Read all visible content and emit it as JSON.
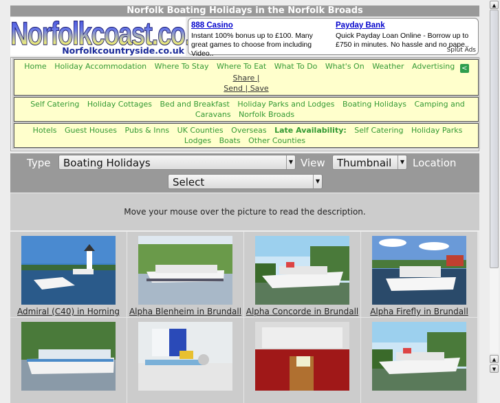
{
  "title": "Norfolk Boating Holidays in the Norfolk Broads",
  "logo": {
    "main": "Norfolkcoast.co.uk",
    "sub": "Norfolkcountryside.co.uk"
  },
  "ads": [
    {
      "title": "888 Casino",
      "text": "Instant 100% bonus up to £100. Many great games to choose from including Video.."
    },
    {
      "title": "Payday Bank",
      "text": "Quick Payday Loan Online - Borrow up to £750 in minutes. No hassle and no pape.."
    }
  ],
  "ads_label": "Splut Ads",
  "nav_main": [
    "Home",
    "Holiday Accommodation",
    "Where To Stay",
    "Where To Eat",
    "What To Do",
    "What's On",
    "Weather",
    "Advertising"
  ],
  "share": {
    "icon": "share-icon",
    "share": "Share |",
    "send_save": "Send | Save"
  },
  "nav_types": [
    "Self Catering",
    "Holiday Cottages",
    "Bed and Breakfast",
    "Holiday Parks and Lodges",
    "Boating Holidays",
    "Camping and Caravans",
    "Norfolk Broads"
  ],
  "nav_other": [
    "Hotels",
    "Guest Houses",
    "Pubs & Inns",
    "UK Counties",
    "Overseas"
  ],
  "late_label": "Late Availability:",
  "nav_late": [
    "Self Catering",
    "Holiday Parks Lodges",
    "Boats",
    "Other Counties"
  ],
  "filter": {
    "type_label": "Type",
    "type_value": "Boating Holidays",
    "view_label": "View",
    "view_value": "Thumbnail",
    "location_label": "Location",
    "location_value": "Select"
  },
  "info": "Move your mouse over the picture to read the description.",
  "listings": [
    {
      "caption": "Admiral (C40) in Horning",
      "scene": "windmill"
    },
    {
      "caption": "Alpha Blenheim in Brundall",
      "scene": "trees-boat"
    },
    {
      "caption": "Alpha Concorde in Brundall",
      "scene": "cruiser"
    },
    {
      "caption": "Alpha Firefly in Brundall",
      "scene": "cruiser-sky"
    },
    {
      "caption": "",
      "scene": "blue-boat"
    },
    {
      "caption": "",
      "scene": "galley"
    },
    {
      "caption": "",
      "scene": "saloon"
    },
    {
      "caption": "",
      "scene": "cruiser"
    }
  ],
  "scroll_position": 0
}
